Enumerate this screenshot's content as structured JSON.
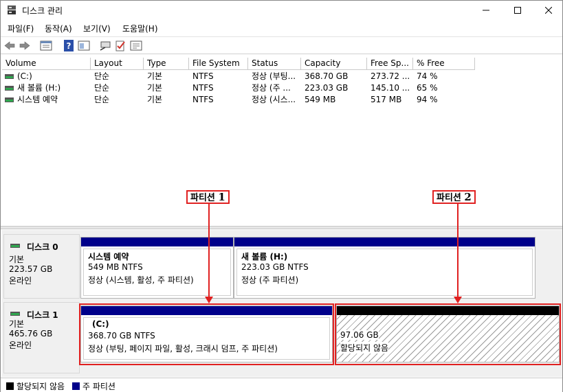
{
  "window": {
    "title": "디스크 관리",
    "controls": {
      "minimize": "—",
      "maximize": "☐",
      "close": "✕"
    }
  },
  "menu": [
    "파일(F)",
    "동작(A)",
    "보기(V)",
    "도움말(H)"
  ],
  "toolbar": [
    "back-icon",
    "forward-icon",
    "properties-icon",
    "help-icon",
    "show-hide-icon",
    "connect-icon",
    "check-icon",
    "settings-icon"
  ],
  "volume_table": {
    "columns": [
      "Volume",
      "Layout",
      "Type",
      "File System",
      "Status",
      "Capacity",
      "Free Sp...",
      "% Free"
    ],
    "rows": [
      {
        "volume": "(C:)",
        "layout": "단순",
        "type": "기본",
        "fs": "NTFS",
        "status": "정상 (부팅...",
        "capacity": "368.70 GB",
        "free": "273.72 ...",
        "pct": "74 %"
      },
      {
        "volume": "새 볼륨 (H:)",
        "layout": "단순",
        "type": "기본",
        "fs": "NTFS",
        "status": "정상 (주 ...",
        "capacity": "223.03 GB",
        "free": "145.10 ...",
        "pct": "65 %"
      },
      {
        "volume": "시스템 예약",
        "layout": "단순",
        "type": "기본",
        "fs": "NTFS",
        "status": "정상 (시스...",
        "capacity": "549 MB",
        "free": "517 MB",
        "pct": "94 %"
      }
    ]
  },
  "disks": [
    {
      "name": "디스크 0",
      "kind": "기본",
      "size": "223.57 GB",
      "state": "온라인",
      "partitions": [
        {
          "title": "시스템 예약",
          "size": "549 MB NTFS",
          "status": "정상 (시스템, 활성, 주 파티션)"
        },
        {
          "title": "새 볼륨  (H:)",
          "size": "223.03 GB NTFS",
          "status": "정상 (주 파티션)"
        }
      ]
    },
    {
      "name": "디스크 1",
      "kind": "기본",
      "size": "465.76 GB",
      "state": "온라인",
      "partitions": [
        {
          "title": "(C:)",
          "size": "368.70 GB NTFS",
          "status": "정상 (부팅, 페이지 파일, 활성, 크래시 덤프, 주 파티션)"
        },
        {
          "title": "",
          "size": "97.06 GB",
          "status": "할당되지 않음"
        }
      ]
    }
  ],
  "legend": [
    {
      "label": "할당되지 않음",
      "color": "#000000"
    },
    {
      "label": "주 파티션",
      "color": "#00008a"
    }
  ],
  "annotations": [
    {
      "text": "파티션",
      "number": "1"
    },
    {
      "text": "파티션",
      "number": "2"
    }
  ],
  "colors": {
    "primary_partition": "#00008a",
    "unallocated": "#000000",
    "annotation": "#e02020"
  }
}
